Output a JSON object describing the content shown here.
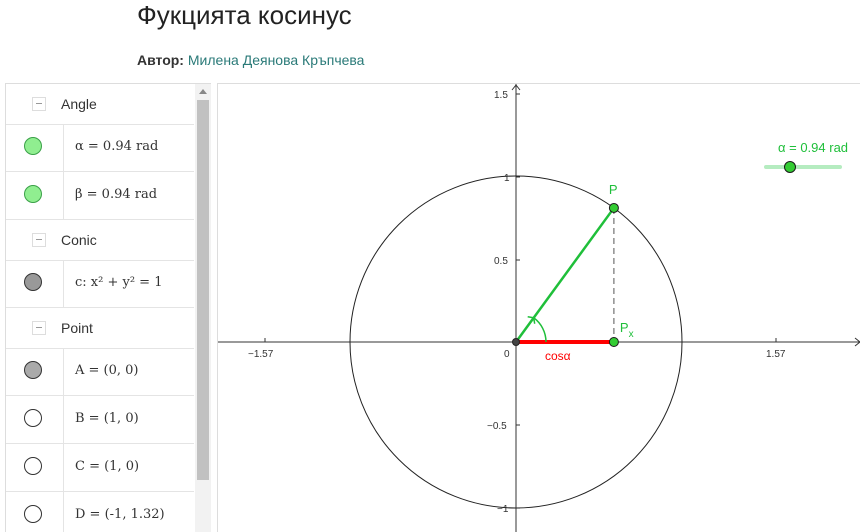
{
  "page": {
    "title": "Фукцията косинус",
    "author_label": "Автор:",
    "author_name": "Милена Деянова Кръпчева"
  },
  "algebra": {
    "groups": [
      {
        "label": "Angle"
      },
      {
        "label": "Conic"
      },
      {
        "label": "Point"
      }
    ],
    "rows": [
      {
        "expr": "α = 0.94 rad",
        "marble": "#90ee90",
        "border": "#3aa048"
      },
      {
        "expr": "β = 0.94 rad",
        "marble": "#90ee90",
        "border": "#3aa048"
      },
      {
        "expr": "c: x² + y² = 1",
        "marble": "#999999",
        "border": "#333333"
      },
      {
        "expr": "A = (0, 0)",
        "marble": "#aaaaaa",
        "border": "#333333"
      },
      {
        "expr": "B = (1, 0)",
        "marble": "#ffffff",
        "border": "#333333"
      },
      {
        "expr": "C = (1, 0)",
        "marble": "#ffffff",
        "border": "#333333"
      },
      {
        "expr": "D = (-1, 1.32)",
        "marble": "#ffffff",
        "border": "#333333"
      }
    ]
  },
  "graphics": {
    "alpha": 0.94,
    "x_ticks": [
      "−1.57",
      "1.57"
    ],
    "y_ticks": [
      "1.5",
      "1",
      "0.5",
      "−0.5",
      "−1"
    ],
    "origin_label": "0",
    "point_p": "P",
    "point_px": "P",
    "point_px_sub": "x",
    "cos_label": "cosα",
    "slider_text": "α = 0.94 rad",
    "colors": {
      "green": "#1fbf3a",
      "red": "#ff0000",
      "axis": "#333333"
    }
  }
}
